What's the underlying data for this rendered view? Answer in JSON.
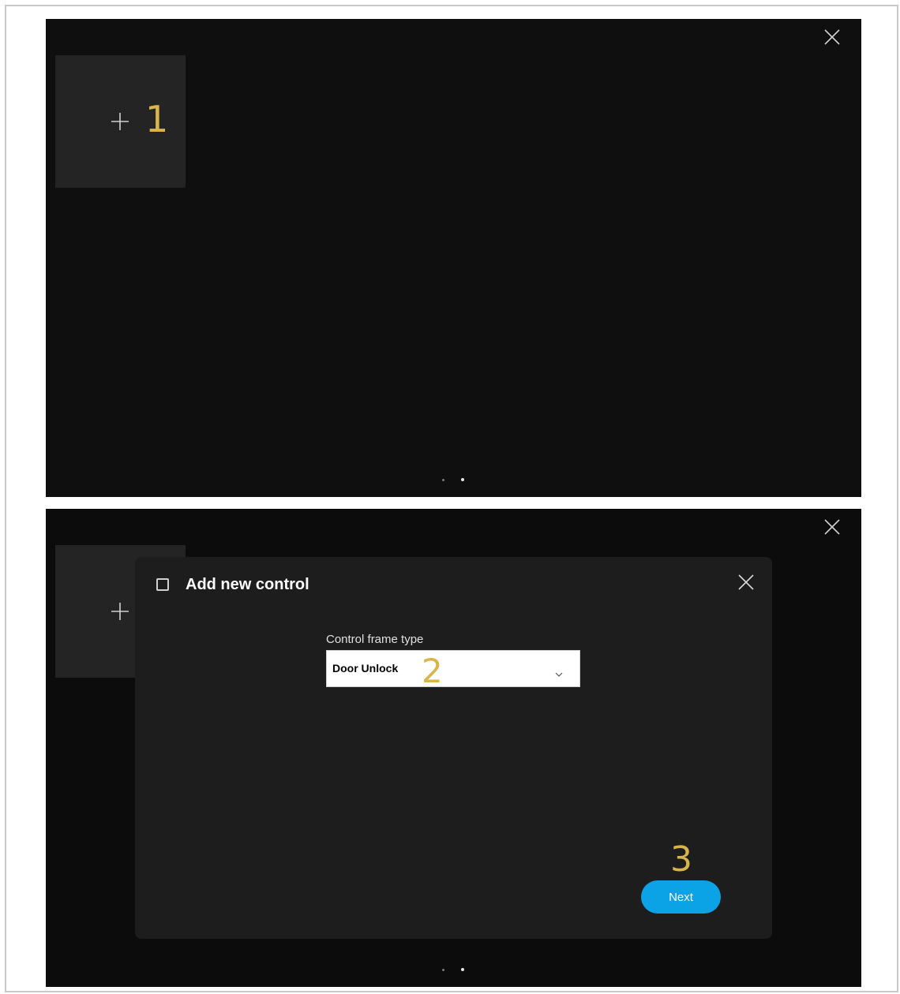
{
  "colors": {
    "screen_background": "#0f0f0f",
    "tile_background": "#242424",
    "dialog_background": "#1d1d1d",
    "marker": "#d8b44a",
    "primary_button": "#0ba3e6"
  },
  "icons": [
    "close-icon",
    "plus-icon",
    "checkbox-icon",
    "chevron-down-icon"
  ],
  "screen1": {
    "add_tile": {
      "plus_symbol": "+"
    },
    "marker": "1",
    "pagination": {
      "pages": 2,
      "current": 2
    }
  },
  "screen2": {
    "add_tile": {
      "plus_symbol": "+"
    },
    "pagination": {
      "pages": 2,
      "current": 2
    },
    "dialog": {
      "title": "Add new control",
      "field_label": "Control frame type",
      "select_value": "Door Unlock",
      "select_marker": "2",
      "next_marker": "3",
      "next_label": "Next"
    }
  }
}
